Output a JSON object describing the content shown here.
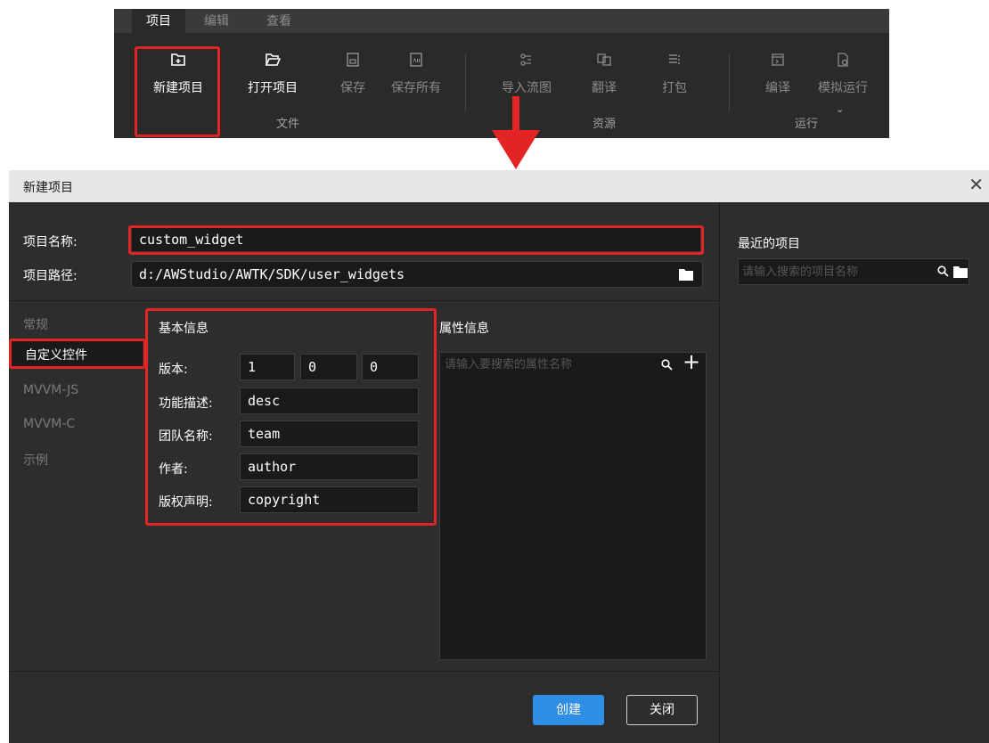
{
  "ribbon": {
    "tabs": [
      "项目",
      "编辑",
      "查看"
    ],
    "buttons": [
      {
        "label": "新建项目",
        "icon": "new-project-icon",
        "enabled": true
      },
      {
        "label": "打开项目",
        "icon": "open-folder-icon",
        "enabled": true
      },
      {
        "label": "保存",
        "icon": "save-icon",
        "enabled": false
      },
      {
        "label": "保存所有",
        "icon": "save-all-icon",
        "enabled": false
      },
      {
        "label": "导入流图",
        "icon": "import-flow-icon",
        "enabled": false
      },
      {
        "label": "翻译",
        "icon": "translate-icon",
        "enabled": false
      },
      {
        "label": "打包",
        "icon": "package-icon",
        "enabled": false
      },
      {
        "label": "编译",
        "icon": "compile-icon",
        "enabled": false
      },
      {
        "label": "模拟运行",
        "icon": "simulate-icon",
        "enabled": false
      }
    ],
    "groups": [
      "文件",
      "资源",
      "运行"
    ]
  },
  "dialog": {
    "title": "新建项目",
    "project_name_label": "项目名称:",
    "project_name_value": "custom_widget",
    "project_path_label": "项目路径:",
    "project_path_value": "d:/AWStudio/AWTK/SDK/user_widgets",
    "recent_title": "最近的项目",
    "recent_search_placeholder": "请输入搜索的项目名称",
    "nav": [
      "常规",
      "自定义控件",
      "MVVM-JS",
      "MVVM-C",
      "示例"
    ],
    "selected_nav": "自定义控件",
    "basic_info": {
      "title": "基本信息",
      "version_label": "版本:",
      "version": [
        "1",
        "0",
        "0"
      ],
      "desc_label": "功能描述:",
      "desc_value": "desc",
      "team_label": "团队名称:",
      "team_value": "team",
      "author_label": "作者:",
      "author_value": "author",
      "copyright_label": "版权声明:",
      "copyright_value": "copyright"
    },
    "prop_info": {
      "title": "属性信息",
      "search_placeholder": "请输入要搜索的属性名称"
    },
    "create_button": "创建",
    "close_button": "关闭"
  },
  "colors": {
    "highlight": "#e32424",
    "accent": "#2f8ee8"
  }
}
